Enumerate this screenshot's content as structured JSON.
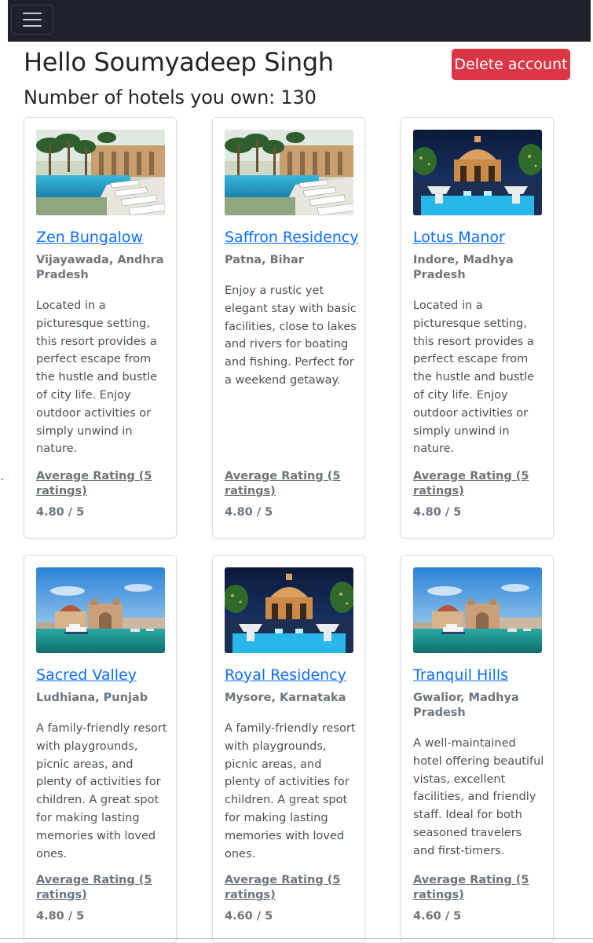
{
  "user": {
    "greeting": "Hello Soumyadeep Singh",
    "hotel_count_text": "Number of hotels you own: 130"
  },
  "actions": {
    "delete_label": "Delete account"
  },
  "colors": {
    "navbar": "#1f2329",
    "danger": "#dc3545",
    "link": "#0d6efd",
    "muted": "#6c757d"
  },
  "hotels": [
    {
      "name": "Zen Bungalow",
      "location": "Vijayawada, Andhra Pradesh",
      "description": "Located in a picturesque setting, this resort provides a perfect escape from the hustle and bustle of city life. Enjoy outdoor activities or simply unwind in nature.",
      "rating_label": "Average Rating (5 ratings)",
      "rating_value": "4.80 / 5",
      "image": "pool-resort"
    },
    {
      "name": "Saffron Residency",
      "location": "Patna, Bihar",
      "description": "Enjoy a rustic yet elegant stay with basic facilities, close to lakes and rivers for boating and fishing. Perfect for a weekend getaway.",
      "rating_label": "Average Rating (5 ratings)",
      "rating_value": "4.80 / 5",
      "image": "pool-resort"
    },
    {
      "name": "Lotus Manor",
      "location": "Indore, Madhya Pradesh",
      "description": "Located in a picturesque setting, this resort provides a perfect escape from the hustle and bustle of city life. Enjoy outdoor activities or simply unwind in nature.",
      "rating_label": "Average Rating (5 ratings)",
      "rating_value": "4.80 / 5",
      "image": "palace-night"
    },
    {
      "name": "Sacred Valley",
      "location": "Ludhiana, Punjab",
      "description": "A family-friendly resort with playgrounds, picnic areas, and plenty of activities for children. A great spot for making lasting memories with loved ones.",
      "rating_label": "Average Rating (5 ratings)",
      "rating_value": "4.80 / 5",
      "image": "gateway-sea"
    },
    {
      "name": "Royal Residency",
      "location": "Mysore, Karnataka",
      "description": "A family-friendly resort with playgrounds, picnic areas, and plenty of activities for children. A great spot for making lasting memories with loved ones.",
      "rating_label": "Average Rating (5 ratings)",
      "rating_value": "4.60 / 5",
      "image": "palace-night"
    },
    {
      "name": "Tranquil Hills",
      "location": "Gwalior, Madhya Pradesh",
      "description": "A well-maintained hotel offering beautiful vistas, excellent facilities, and friendly staff. Ideal for both seasoned travelers and first-timers.",
      "rating_label": "Average Rating (5 ratings)",
      "rating_value": "4.60 / 5",
      "image": "gateway-sea"
    }
  ]
}
